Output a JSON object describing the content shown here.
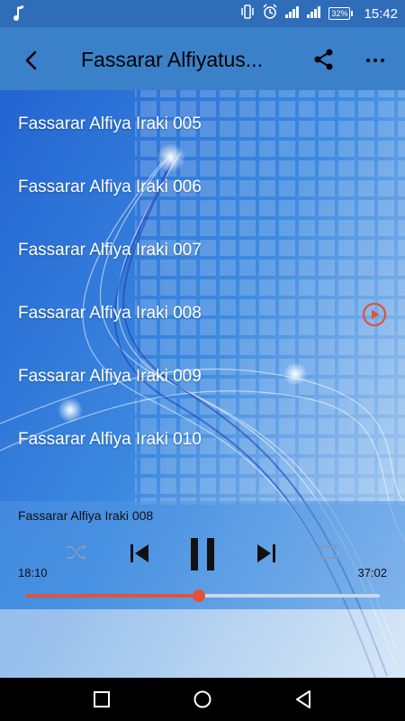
{
  "status_bar": {
    "battery_percent": "32%",
    "time": "15:42",
    "icons": [
      "music-note-icon",
      "vibrate-icon",
      "alarm-icon",
      "signal-icon",
      "signal-icon",
      "battery-icon"
    ]
  },
  "toolbar": {
    "title": "Fassarar Alfiyatus...",
    "icons": [
      "back-arrow-icon",
      "share-icon",
      "more-dots-icon"
    ]
  },
  "tracks": [
    {
      "label": "Fassarar Alfiya Iraki 005",
      "playing": false
    },
    {
      "label": "Fassarar Alfiya Iraki 006",
      "playing": false
    },
    {
      "label": "Fassarar Alfiya Iraki 007",
      "playing": false
    },
    {
      "label": "Fassarar Alfiya Iraki 008",
      "playing": true
    },
    {
      "label": "Fassarar Alfiya Iraki 009",
      "playing": false
    },
    {
      "label": "Fassarar Alfiya Iraki 010",
      "playing": false
    }
  ],
  "player": {
    "now_playing": "Fassarar Alfiya Iraki 008",
    "elapsed": "18:10",
    "total": "37:02",
    "progress_fraction": 0.49,
    "controls": [
      "shuffle-icon",
      "previous-icon",
      "pause-icon",
      "next-icon",
      "repeat-icon"
    ]
  },
  "colors": {
    "accent": "#e0533a",
    "toolbar": "#3a81c9",
    "status_bar": "#2f6db8"
  },
  "nav_bar": {
    "icons": [
      "recents-square-icon",
      "home-circle-icon",
      "back-triangle-icon"
    ]
  }
}
